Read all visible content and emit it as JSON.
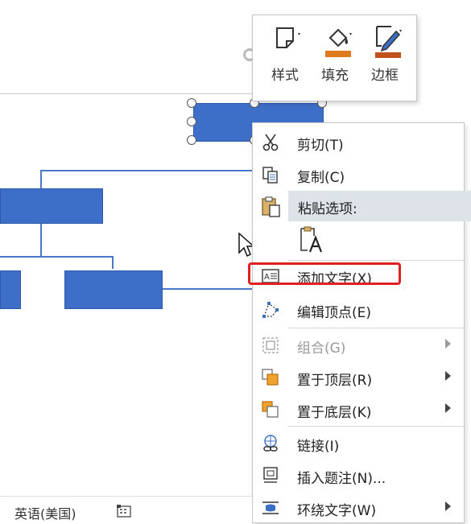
{
  "mini_toolbar": {
    "style_label": "样式",
    "fill_label": "填充",
    "border_label": "边框"
  },
  "menu": {
    "cut": "剪切(T)",
    "copy": "复制(C)",
    "paste_options": "粘贴选项:",
    "add_text": "添加文字(X)",
    "edit_points": "编辑顶点(E)",
    "group": "组合(G)",
    "bring_to_front": "置于顶层(R)",
    "send_to_back": "置于底层(K)",
    "link": "链接(I)",
    "insert_caption": "插入题注(N)...",
    "wrap_text": "环绕文字(W)"
  },
  "status_bar": {
    "language": "英语(美国)"
  },
  "colors": {
    "shape_fill": "#3d6fc9",
    "highlight": "#e02020",
    "paste_header_bg": "#dde3e8"
  }
}
